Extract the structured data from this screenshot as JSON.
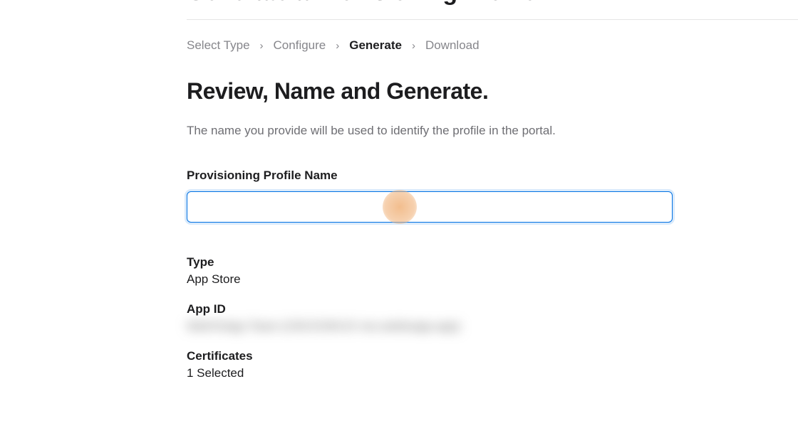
{
  "page_title": "Generate a Provisioning Profile",
  "breadcrumb": {
    "items": [
      {
        "label": "Select Type",
        "active": false
      },
      {
        "label": "Configure",
        "active": false
      },
      {
        "label": "Generate",
        "active": true
      },
      {
        "label": "Download",
        "active": false
      }
    ]
  },
  "section": {
    "heading": "Review, Name and Generate.",
    "description": "The name you provide will be used to identify the profile in the portal."
  },
  "form": {
    "profile_name_label": "Provisioning Profile Name",
    "profile_name_value": ""
  },
  "summary": {
    "type_label": "Type",
    "type_value": "App Store",
    "app_id_label": "App ID",
    "app_id_value": "WebToApp Team (C8XJCMXJX me.webtoapp.app)",
    "certificates_label": "Certificates",
    "certificates_value": "1 Selected"
  }
}
